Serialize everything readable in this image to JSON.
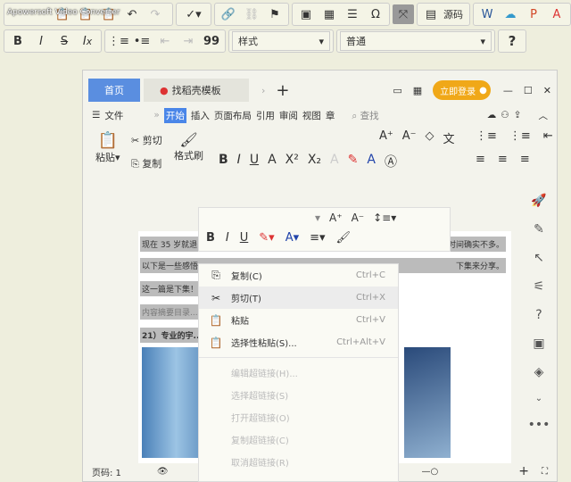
{
  "watermark": "Apowersoft Video Converter",
  "editor_toolbar": {
    "row1": [
      "paste-icon",
      "paste-text-icon",
      "paste-word-icon",
      "undo-icon",
      "redo-icon",
      "spellcheck-icon",
      "link-icon",
      "unlink-icon",
      "anchor-icon",
      "image-icon",
      "table-icon",
      "horizontal-rule-icon",
      "special-char-icon",
      "maximize-icon",
      "source-icon",
      "word-icon",
      "cloud-icon",
      "ppt-icon",
      "pdf-icon"
    ],
    "source_label": "源码",
    "row2": [
      "B",
      "I",
      "S",
      "Ix"
    ],
    "styles_select": "样式",
    "format_select": "普通",
    "help": "?"
  },
  "wps": {
    "tabs": [
      {
        "label": "首页"
      },
      {
        "label": "找稻壳模板"
      }
    ],
    "login_button": "立即登录",
    "menu": {
      "file": "文件",
      "items": [
        "开始",
        "插入",
        "页面布局",
        "引用",
        "审阅",
        "视图",
        "章"
      ],
      "active": "开始",
      "search": "查找"
    },
    "ribbon": {
      "paste": "粘贴",
      "cut": "剪切",
      "copy": "复制",
      "format_painter": "格式刷"
    },
    "document": {
      "lines": [
        "现在 35 岁就退...",
        "以下是一些感悟...",
        "这一篇是下集！",
        "内容摘要目录...",
        "21）专业的宇..."
      ],
      "right_1": "时间确实不多。",
      "right_2": "下集来分享。"
    },
    "context_menu": [
      {
        "label": "复制(C)",
        "shortcut": "Ctrl+C",
        "icon": "copy-icon",
        "enabled": true
      },
      {
        "label": "剪切(T)",
        "shortcut": "Ctrl+X",
        "icon": "scissors-icon",
        "enabled": true
      },
      {
        "label": "粘贴",
        "shortcut": "Ctrl+V",
        "icon": "paste-icon",
        "enabled": true
      },
      {
        "label": "选择性粘贴(S)...",
        "shortcut": "Ctrl+Alt+V",
        "icon": "paste-special-icon",
        "enabled": true
      },
      {
        "label": "编辑超链接(H)...",
        "shortcut": "",
        "enabled": false
      },
      {
        "label": "选择超链接(S)",
        "shortcut": "",
        "enabled": false
      },
      {
        "label": "打开超链接(O)",
        "shortcut": "",
        "enabled": false
      },
      {
        "label": "复制超链接(C)",
        "shortcut": "",
        "enabled": false
      },
      {
        "label": "取消超链接(R)",
        "shortcut": "",
        "enabled": false
      }
    ],
    "status": {
      "page": "页码: 1"
    }
  }
}
